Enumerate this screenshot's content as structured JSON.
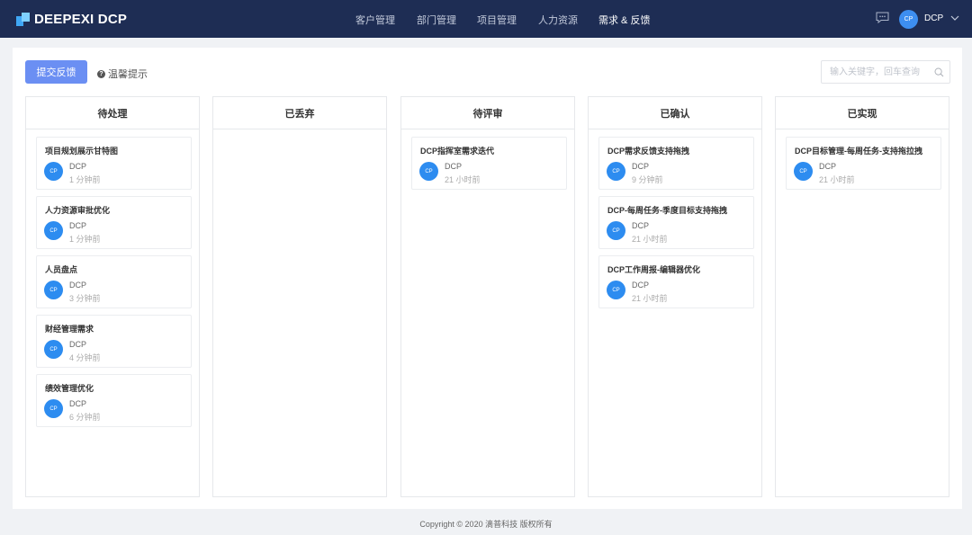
{
  "brand": {
    "name": "DEEPEXI DCP"
  },
  "nav": [
    {
      "label": "客户管理",
      "active": false
    },
    {
      "label": "部门管理",
      "active": false
    },
    {
      "label": "项目管理",
      "active": false
    },
    {
      "label": "人力资源",
      "active": false
    },
    {
      "label": "需求 & 反馈",
      "active": true
    }
  ],
  "user": {
    "avatar": "CP",
    "name": "DCP"
  },
  "toolbar": {
    "submit_label": "提交反馈",
    "tip_label": "温馨提示"
  },
  "search": {
    "placeholder": "输入关键字，回车查询"
  },
  "columns": [
    {
      "title": "待处理",
      "cards": [
        {
          "title": "项目规划展示甘特图",
          "avatar": "CP",
          "author": "DCP",
          "time": "1 分钟前"
        },
        {
          "title": "人力资源审批优化",
          "avatar": "CP",
          "author": "DCP",
          "time": "1 分钟前"
        },
        {
          "title": "人员盘点",
          "avatar": "CP",
          "author": "DCP",
          "time": "3 分钟前"
        },
        {
          "title": "财经管理需求",
          "avatar": "CP",
          "author": "DCP",
          "time": "4 分钟前"
        },
        {
          "title": "绩效管理优化",
          "avatar": "CP",
          "author": "DCP",
          "time": "6 分钟前"
        }
      ]
    },
    {
      "title": "已丢弃",
      "cards": []
    },
    {
      "title": "待评审",
      "cards": [
        {
          "title": "DCP指挥室需求迭代",
          "avatar": "CP",
          "author": "DCP",
          "time": "21 小时前"
        }
      ]
    },
    {
      "title": "已确认",
      "cards": [
        {
          "title": "DCP需求反馈支持拖拽",
          "avatar": "CP",
          "author": "DCP",
          "time": "9 分钟前"
        },
        {
          "title": "DCP-每周任务-季度目标支持拖拽",
          "avatar": "CP",
          "author": "DCP",
          "time": "21 小时前"
        },
        {
          "title": "DCP工作周报-编辑器优化",
          "avatar": "CP",
          "author": "DCP",
          "time": "21 小时前"
        }
      ]
    },
    {
      "title": "已实现",
      "cards": [
        {
          "title": "DCP目标管理-每周任务-支持拖拉拽",
          "avatar": "CP",
          "author": "DCP",
          "time": "21 小时前"
        }
      ]
    }
  ],
  "footer": {
    "text": "Copyright © 2020 滴普科技 版权所有"
  },
  "icons": {
    "message": "message-icon",
    "chevron": "chevron-down-icon",
    "search": "search-icon",
    "help": "question-circle-icon"
  },
  "colors": {
    "topbar": "#1e2d54",
    "primary": "#6b8ff3",
    "avatar": "#2d8cf0"
  }
}
